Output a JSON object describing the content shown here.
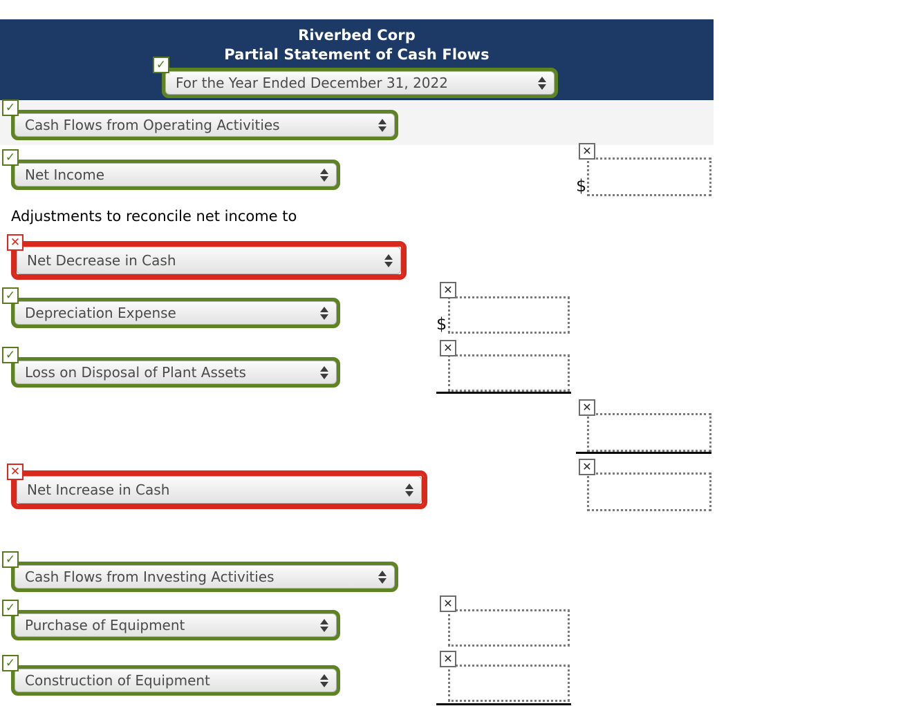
{
  "statement": {
    "company": "Riverbed Corp",
    "title": "Partial Statement of Cash Flows",
    "period_select": "For the Year Ended December 31, 2022",
    "note_line": "Adjustments to reconcile net income to"
  },
  "colors": {
    "header_navy": "#1d3a66",
    "subheader_gray": "#f4f4f4",
    "valid_green": "#5d8323",
    "error_red": "#d9291c",
    "box_border_gray": "#7a7a7a"
  },
  "icons": {
    "check": "✓",
    "cross": "✕",
    "arrow_up": "▲",
    "arrow_down": "▼",
    "currency": "$"
  },
  "selects": [
    {
      "id": "period",
      "value": "For the Year Ended December 31, 2022",
      "status": "correct"
    },
    {
      "id": "operating-section",
      "value": "Cash Flows from Operating Activities",
      "status": "correct"
    },
    {
      "id": "net-income",
      "value": "Net Income",
      "status": "correct"
    },
    {
      "id": "net-decrease-cash",
      "value": "Net Decrease in Cash",
      "status": "incorrect"
    },
    {
      "id": "depreciation",
      "value": "Depreciation Expense",
      "status": "correct"
    },
    {
      "id": "loss-disposal",
      "value": "Loss on Disposal of Plant Assets",
      "status": "correct"
    },
    {
      "id": "net-increase-cash",
      "value": "Net Increase in Cash",
      "status": "incorrect"
    },
    {
      "id": "investing-section",
      "value": "Cash Flows from Investing Activities",
      "status": "correct"
    },
    {
      "id": "purchase-equipment",
      "value": "Purchase of Equipment",
      "status": "correct"
    },
    {
      "id": "construction-equip",
      "value": "Construction of Equipment",
      "status": "correct"
    }
  ],
  "amount_fields": [
    {
      "id": "net-income-amount",
      "value": "",
      "status": "incorrect",
      "currency": "$"
    },
    {
      "id": "depreciation-amount",
      "value": "",
      "status": "incorrect",
      "currency": "$"
    },
    {
      "id": "loss-disposal-amount",
      "value": "",
      "status": "incorrect",
      "currency": ""
    },
    {
      "id": "total-adjustments-amount",
      "value": "",
      "status": "incorrect",
      "currency": ""
    },
    {
      "id": "net-operating-amount",
      "value": "",
      "status": "incorrect",
      "currency": ""
    },
    {
      "id": "purchase-equip-amount",
      "value": "",
      "status": "incorrect",
      "currency": ""
    },
    {
      "id": "construction-amount",
      "value": "",
      "status": "incorrect",
      "currency": ""
    }
  ]
}
